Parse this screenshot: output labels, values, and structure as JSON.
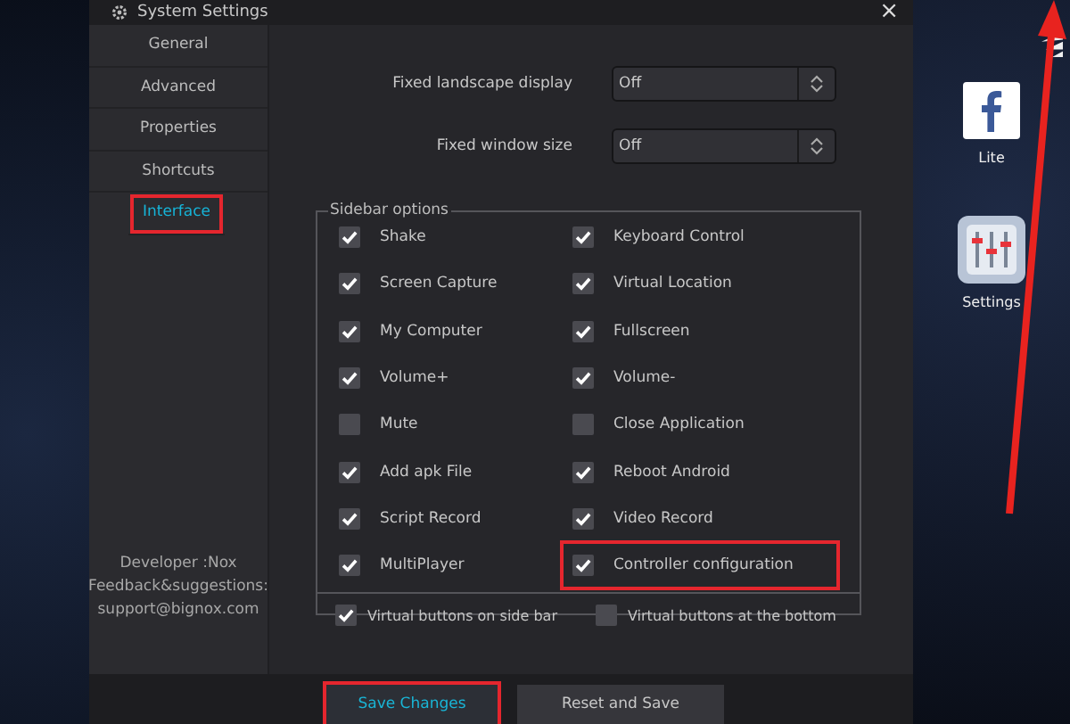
{
  "window": {
    "title": "System Settings",
    "close": "×"
  },
  "sidebar": {
    "items": [
      {
        "label": "General",
        "selected": false,
        "highlighted": false
      },
      {
        "label": "Advanced",
        "selected": false,
        "highlighted": false
      },
      {
        "label": "Properties",
        "selected": false,
        "highlighted": false
      },
      {
        "label": "Shortcuts",
        "selected": false,
        "highlighted": false
      },
      {
        "label": "Interface",
        "selected": true,
        "highlighted": true
      }
    ],
    "footer": [
      "Developer :Nox",
      "Feedback&suggestions:",
      "support@bignox.com"
    ]
  },
  "settings": [
    {
      "label": "Fixed landscape display",
      "value": "Off"
    },
    {
      "label": "Fixed window size",
      "value": "Off"
    }
  ],
  "sidebar_options": {
    "title": "Sidebar options",
    "items": [
      {
        "label": "Shake",
        "checked": true,
        "highlighted": false
      },
      {
        "label": "Keyboard Control",
        "checked": true,
        "highlighted": false
      },
      {
        "label": "Screen Capture",
        "checked": true,
        "highlighted": false
      },
      {
        "label": "Virtual Location",
        "checked": true,
        "highlighted": false
      },
      {
        "label": "My Computer",
        "checked": true,
        "highlighted": false
      },
      {
        "label": "Fullscreen",
        "checked": true,
        "highlighted": false
      },
      {
        "label": "Volume+",
        "checked": true,
        "highlighted": false
      },
      {
        "label": "Volume-",
        "checked": true,
        "highlighted": false
      },
      {
        "label": "Mute",
        "checked": false,
        "highlighted": false
      },
      {
        "label": "Close Application",
        "checked": false,
        "highlighted": false
      },
      {
        "label": "Add apk File",
        "checked": true,
        "highlighted": false
      },
      {
        "label": "Reboot Android",
        "checked": true,
        "highlighted": false
      },
      {
        "label": "Script Record",
        "checked": true,
        "highlighted": false
      },
      {
        "label": "Video Record",
        "checked": true,
        "highlighted": false
      },
      {
        "label": "MultiPlayer",
        "checked": true,
        "highlighted": false
      },
      {
        "label": "Controller configuration",
        "checked": true,
        "highlighted": true
      }
    ],
    "bottom": [
      {
        "label": "Virtual buttons on side bar",
        "checked": true
      },
      {
        "label": "Virtual buttons at the bottom",
        "checked": false
      }
    ]
  },
  "buttons": [
    {
      "label": "Save Changes",
      "kind": "primary",
      "highlighted": true
    },
    {
      "label": "Reset and Save",
      "kind": "secondary",
      "highlighted": false
    }
  ],
  "desktop_apps": [
    {
      "label": "Lite",
      "kind": "facebook"
    },
    {
      "label": "Settings",
      "kind": "settings"
    }
  ]
}
